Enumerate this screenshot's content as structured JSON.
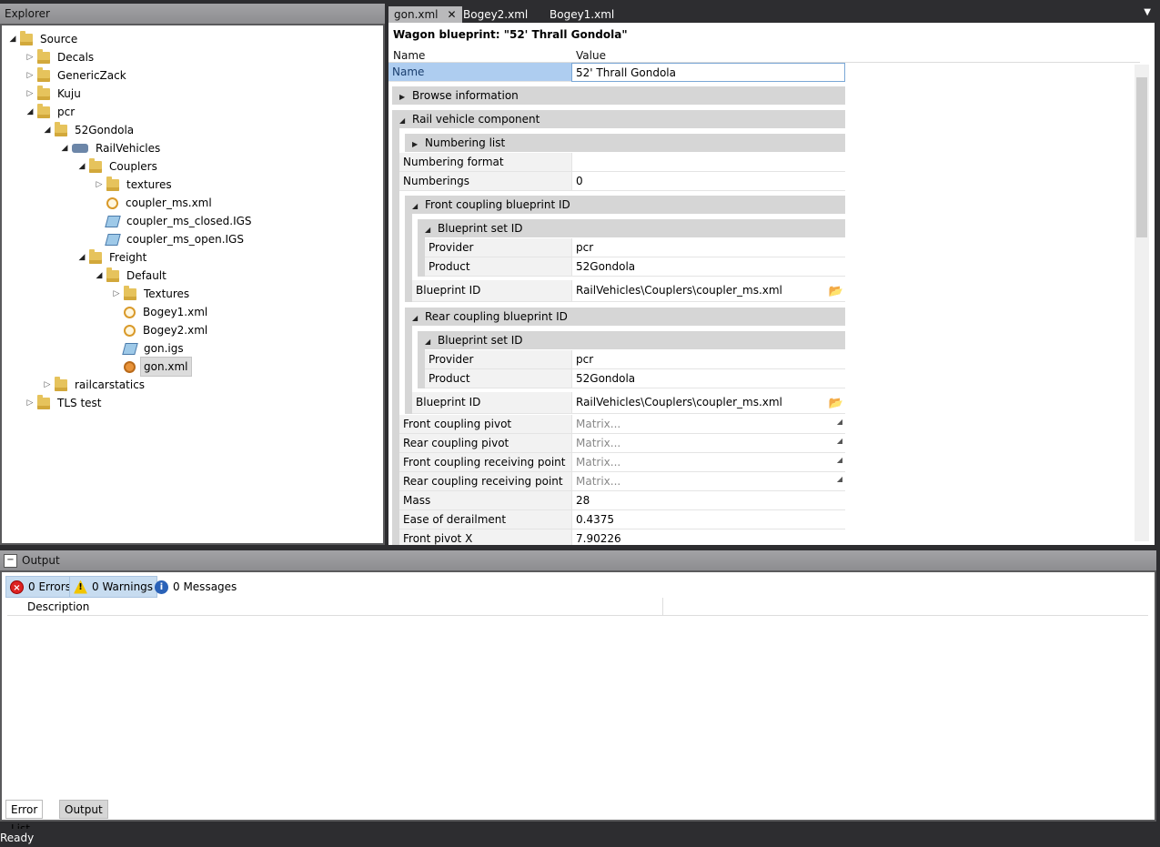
{
  "explorer": {
    "title": "Explorer",
    "items": [
      {
        "label": "Source"
      },
      {
        "label": "Decals"
      },
      {
        "label": "GenericZack"
      },
      {
        "label": "Kuju"
      },
      {
        "label": "pcr"
      },
      {
        "label": "52Gondola"
      },
      {
        "label": "RailVehicles"
      },
      {
        "label": "Couplers"
      },
      {
        "label": "textures"
      },
      {
        "label": "coupler_ms.xml"
      },
      {
        "label": "coupler_ms_closed.IGS"
      },
      {
        "label": "coupler_ms_open.IGS"
      },
      {
        "label": "Freight"
      },
      {
        "label": "Default"
      },
      {
        "label": "Textures"
      },
      {
        "label": "Bogey1.xml"
      },
      {
        "label": "Bogey2.xml"
      },
      {
        "label": "gon.igs"
      },
      {
        "label": "gon.xml"
      },
      {
        "label": "railcarstatics"
      },
      {
        "label": "TLS test"
      }
    ]
  },
  "tabs": [
    {
      "label": "gon.xml",
      "close": "✕"
    },
    {
      "label": "Bogey2.xml"
    },
    {
      "label": "Bogey1.xml"
    }
  ],
  "editor": {
    "title": "Wagon blueprint: \"52' Thrall Gondola\"",
    "col_name": "Name",
    "col_value": "Value",
    "name_label": "Name",
    "name_value": "52' Thrall Gondola",
    "browse_info": "Browse information",
    "rail_vehicle": "Rail vehicle component",
    "numbering_list": "Numbering list",
    "numbering_format": "Numbering format",
    "numbering_format_value": "",
    "numberings": "Numberings",
    "numberings_value": "0",
    "front_coupling_bp": "Front coupling blueprint ID",
    "bp_set_id": "Blueprint set ID",
    "provider": "Provider",
    "provider_value": "pcr",
    "product": "Product",
    "product_value": "52Gondola",
    "blueprint_id": "Blueprint ID",
    "blueprint_id_value": "RailVehicles\\Couplers\\coupler_ms.xml",
    "rear_coupling_bp": "Rear coupling blueprint ID",
    "matrix_rows": [
      {
        "label": "Front coupling pivot",
        "value": "Matrix..."
      },
      {
        "label": "Rear coupling pivot",
        "value": "Matrix..."
      },
      {
        "label": "Front coupling receiving point",
        "value": "Matrix..."
      },
      {
        "label": "Rear coupling receiving point",
        "value": "Matrix..."
      }
    ],
    "mass": "Mass",
    "mass_value": "28",
    "ease_derail": "Ease of derailment",
    "ease_derail_value": "0.4375",
    "front_pivot_x": "Front pivot X",
    "front_pivot_x_value": "7.90226"
  },
  "output": {
    "title": "Output",
    "minimize": "−",
    "errors": "0 Errors",
    "warnings": "0 Warnings",
    "messages": "0 Messages",
    "description": "Description",
    "tab_errors": "Error List",
    "tab_output": "Output"
  },
  "status": "Ready"
}
